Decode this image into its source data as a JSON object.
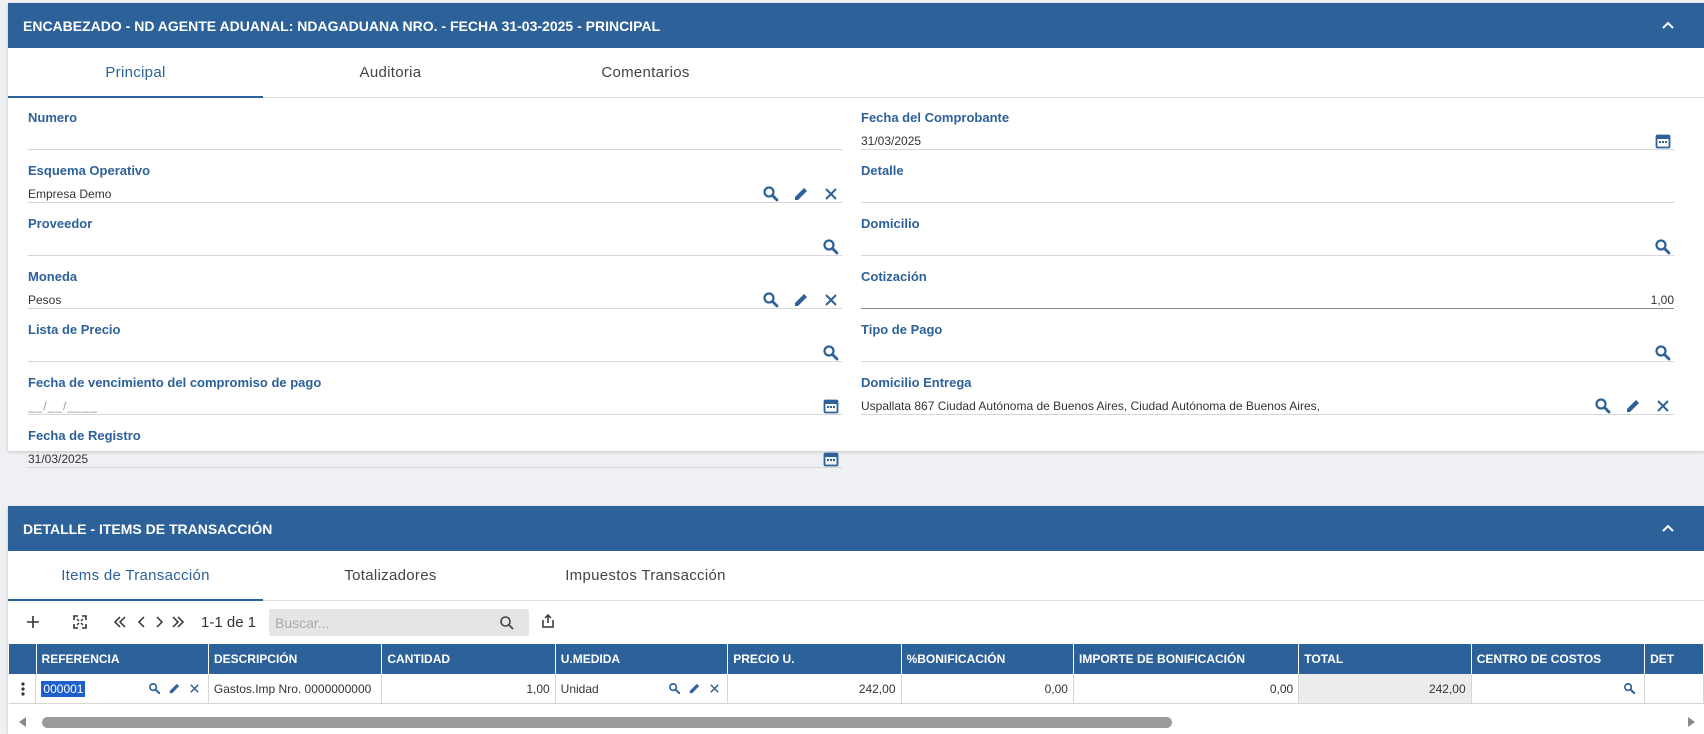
{
  "header_panel": {
    "title": "ENCABEZADO - ND AGENTE ADUANAL: NDAGADUANA NRO. - FECHA 31-03-2025 - PRINCIPAL",
    "tabs": [
      {
        "label": "Principal",
        "active": true
      },
      {
        "label": "Auditoria",
        "active": false
      },
      {
        "label": "Comentarios",
        "active": false
      }
    ],
    "left_fields": [
      {
        "label": "Numero",
        "value": ""
      },
      {
        "label": "Esquema Operativo",
        "value": "Empresa Demo"
      },
      {
        "label": "Proveedor",
        "value": ""
      },
      {
        "label": "Moneda",
        "value": "Pesos"
      },
      {
        "label": "Lista de Precio",
        "value": ""
      },
      {
        "label": "Fecha de vencimiento del compromiso de pago",
        "value": "__/__/____"
      },
      {
        "label": "Fecha de Registro",
        "value": "31/03/2025"
      }
    ],
    "right_fields": [
      {
        "label": "Fecha del Comprobante",
        "value": "31/03/2025"
      },
      {
        "label": "Detalle",
        "value": ""
      },
      {
        "label": "Domicilio",
        "value": ""
      },
      {
        "label": "Cotización",
        "value": "1,00"
      },
      {
        "label": "Tipo de Pago",
        "value": ""
      },
      {
        "label": "Domicilio Entrega",
        "value": "Uspallata 867  Ciudad Autónoma de Buenos Aires, Ciudad Autónoma de Buenos Aires,"
      }
    ]
  },
  "detail_panel": {
    "title": "DETALLE - ITEMS DE TRANSACCIÓN",
    "tabs": [
      {
        "label": "Items de Transacción",
        "active": true
      },
      {
        "label": "Totalizadores",
        "active": false
      },
      {
        "label": "Impuestos Transacción",
        "active": false
      }
    ],
    "toolbar": {
      "pager_text": "1-1 de 1",
      "search_placeholder": "Buscar..."
    },
    "columns": [
      "REFERENCIA",
      "DESCRIPCIÓN",
      "CANTIDAD",
      "U.MEDIDA",
      "PRECIO U.",
      "%BONIFICACIÓN",
      "IMPORTE DE BONIFICACIÓN",
      "TOTAL",
      "CENTRO DE COSTOS",
      "DET"
    ],
    "rows": [
      {
        "referencia": "000001",
        "descripcion": "Gastos.Imp Nro.  0000000000",
        "cantidad": "1,00",
        "umedida": "Unidad",
        "precio": "242,00",
        "bonificacion": "0,00",
        "importe_bonificacion": "0,00",
        "total": "242,00",
        "centro_costos": ""
      }
    ]
  },
  "colors": {
    "header_blue": "#2d6199",
    "background": "#eef0f3"
  }
}
